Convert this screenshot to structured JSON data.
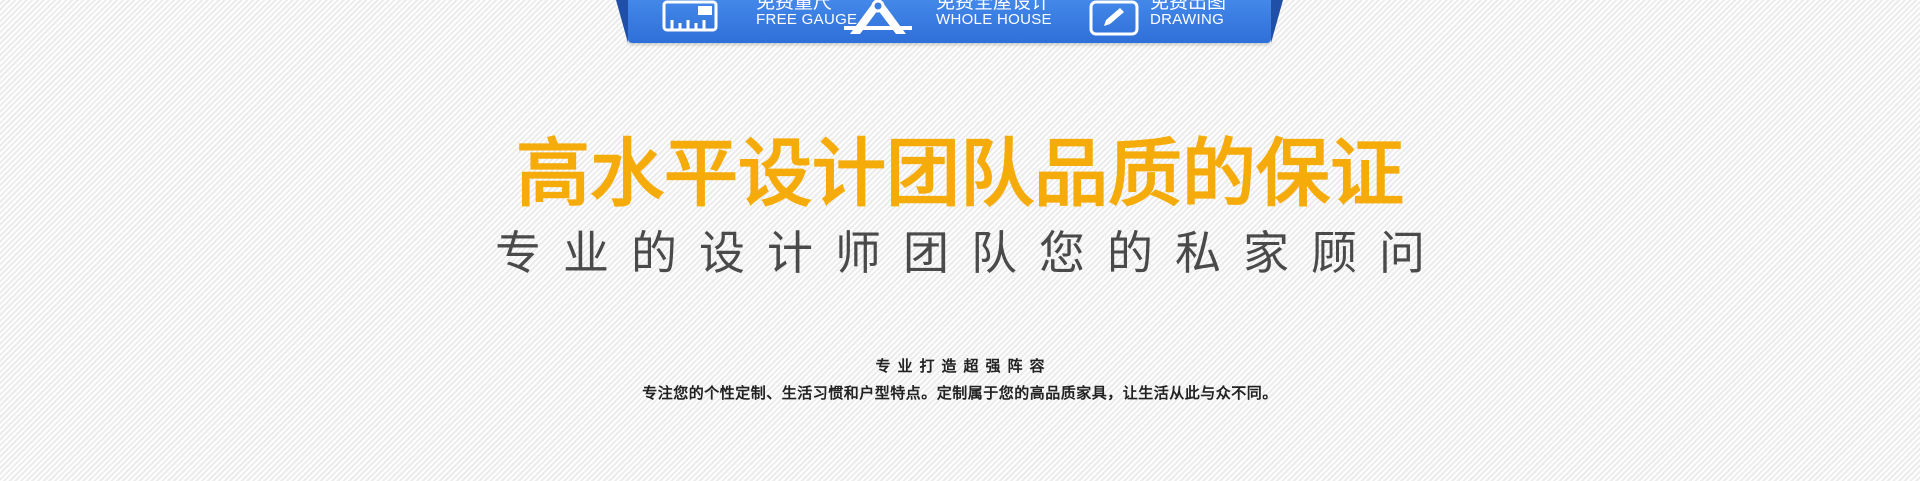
{
  "service_bar": {
    "items": [
      {
        "cn": "免费量尺",
        "en": "FREE GAUGE",
        "icon": "ruler-icon"
      },
      {
        "cn": "免费全屋设计",
        "en": "WHOLE HOUSE",
        "icon": "compass-ruler-icon"
      },
      {
        "cn": "免费出图",
        "en": "DRAWING",
        "icon": "pencil-icon"
      }
    ],
    "colors": {
      "bar": "#3a7de4",
      "text": "#ffffff"
    }
  },
  "main_title": "高水平设计团队品质的保证",
  "subtitle": "专业的设计师团队您的私家顾问",
  "section": {
    "heading": "专业打造超强阵容",
    "description": "专注您的个性定制、生活习惯和户型特点。定制属于您的高品质家具，让生活从此与众不同。"
  },
  "colors": {
    "title": "#f5ac0a",
    "subtitle": "#4a4a4a",
    "body_text": "#222222"
  }
}
